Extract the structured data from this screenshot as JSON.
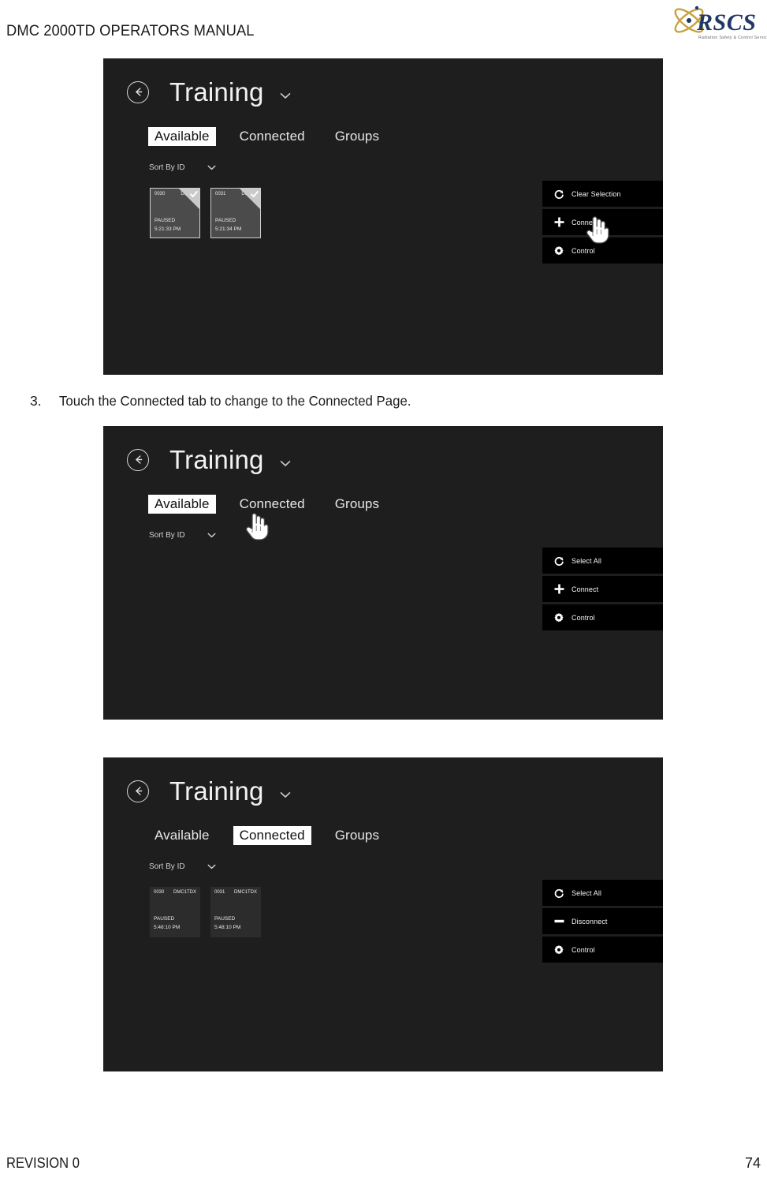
{
  "document": {
    "header_title": "DMC 2000TD OPERATORS MANUAL",
    "logo_text": "RSCS",
    "logo_tagline": "Radiation Safety & Control Services",
    "footer_revision": "REVISION 0",
    "footer_page": "74"
  },
  "instructions": [
    {
      "number": "3.",
      "text": "Touch the Connected tab to change to the Connected Page."
    }
  ],
  "screenshots": [
    {
      "id": "available-page-selected",
      "back_icon": "back-arrow-icon",
      "title": "Training",
      "title_chevron_icon": "chevron-down-icon",
      "tabs": [
        {
          "label": "Available",
          "selected": true
        },
        {
          "label": "Connected",
          "selected": false
        },
        {
          "label": "Groups",
          "selected": false
        }
      ],
      "sort": {
        "label": "Sort By ID",
        "chevron_icon": "chevron-down-icon"
      },
      "tiles": [
        {
          "id": "0030",
          "model": "DMC...",
          "status": "PAUSED",
          "time": "5:21:33 PM",
          "selected": true
        },
        {
          "id": "0031",
          "model": "DMC...",
          "status": "PAUSED",
          "time": "5:21:34 PM",
          "selected": true
        }
      ],
      "actions": [
        {
          "icon": "refresh-icon",
          "label": "Clear Selection"
        },
        {
          "icon": "plus-icon",
          "label": "Connect"
        },
        {
          "icon": "gear-icon",
          "label": "Control"
        }
      ],
      "cursor": {
        "icon": "hand-pointer-icon",
        "over": "Connect"
      }
    },
    {
      "id": "available-page-hover-connected",
      "back_icon": "back-arrow-icon",
      "title": "Training",
      "title_chevron_icon": "chevron-down-icon",
      "tabs": [
        {
          "label": "Available",
          "selected": true
        },
        {
          "label": "Connected",
          "selected": false
        },
        {
          "label": "Groups",
          "selected": false
        }
      ],
      "sort": {
        "label": "Sort By ID",
        "chevron_icon": "chevron-down-icon"
      },
      "tiles": [],
      "actions": [
        {
          "icon": "refresh-icon",
          "label": "Select All"
        },
        {
          "icon": "plus-icon",
          "label": "Connect"
        },
        {
          "icon": "gear-icon",
          "label": "Control"
        }
      ],
      "cursor": {
        "icon": "hand-pointer-icon",
        "over": "Connected tab"
      }
    },
    {
      "id": "connected-page",
      "back_icon": "back-arrow-icon",
      "title": "Training",
      "title_chevron_icon": "chevron-down-icon",
      "tabs": [
        {
          "label": "Available",
          "selected": false
        },
        {
          "label": "Connected",
          "selected": true
        },
        {
          "label": "Groups",
          "selected": false
        }
      ],
      "sort": {
        "label": "Sort By ID",
        "chevron_icon": "chevron-down-icon"
      },
      "tiles": [
        {
          "id": "0030",
          "model": "DMC1TDX",
          "status": "PAUSED",
          "time": "5:48:10 PM",
          "selected": false
        },
        {
          "id": "0031",
          "model": "DMC1TDX",
          "status": "PAUSED",
          "time": "5:48:10 PM",
          "selected": false
        }
      ],
      "actions": [
        {
          "icon": "refresh-icon",
          "label": "Select All"
        },
        {
          "icon": "minus-icon",
          "label": "Disconnect"
        },
        {
          "icon": "gear-icon",
          "label": "Control"
        }
      ],
      "cursor": null
    }
  ],
  "colors": {
    "panel_background": "#1e1e1e",
    "action_button_background": "#000000",
    "tile_selected_background": "#4b4b4b",
    "tile_background": "#2c2c2c",
    "tab_selected_background": "#ffffff",
    "text_primary": "#f2f2f2",
    "logo_navy": "#1f3864",
    "logo_gold": "#c8a13c"
  }
}
